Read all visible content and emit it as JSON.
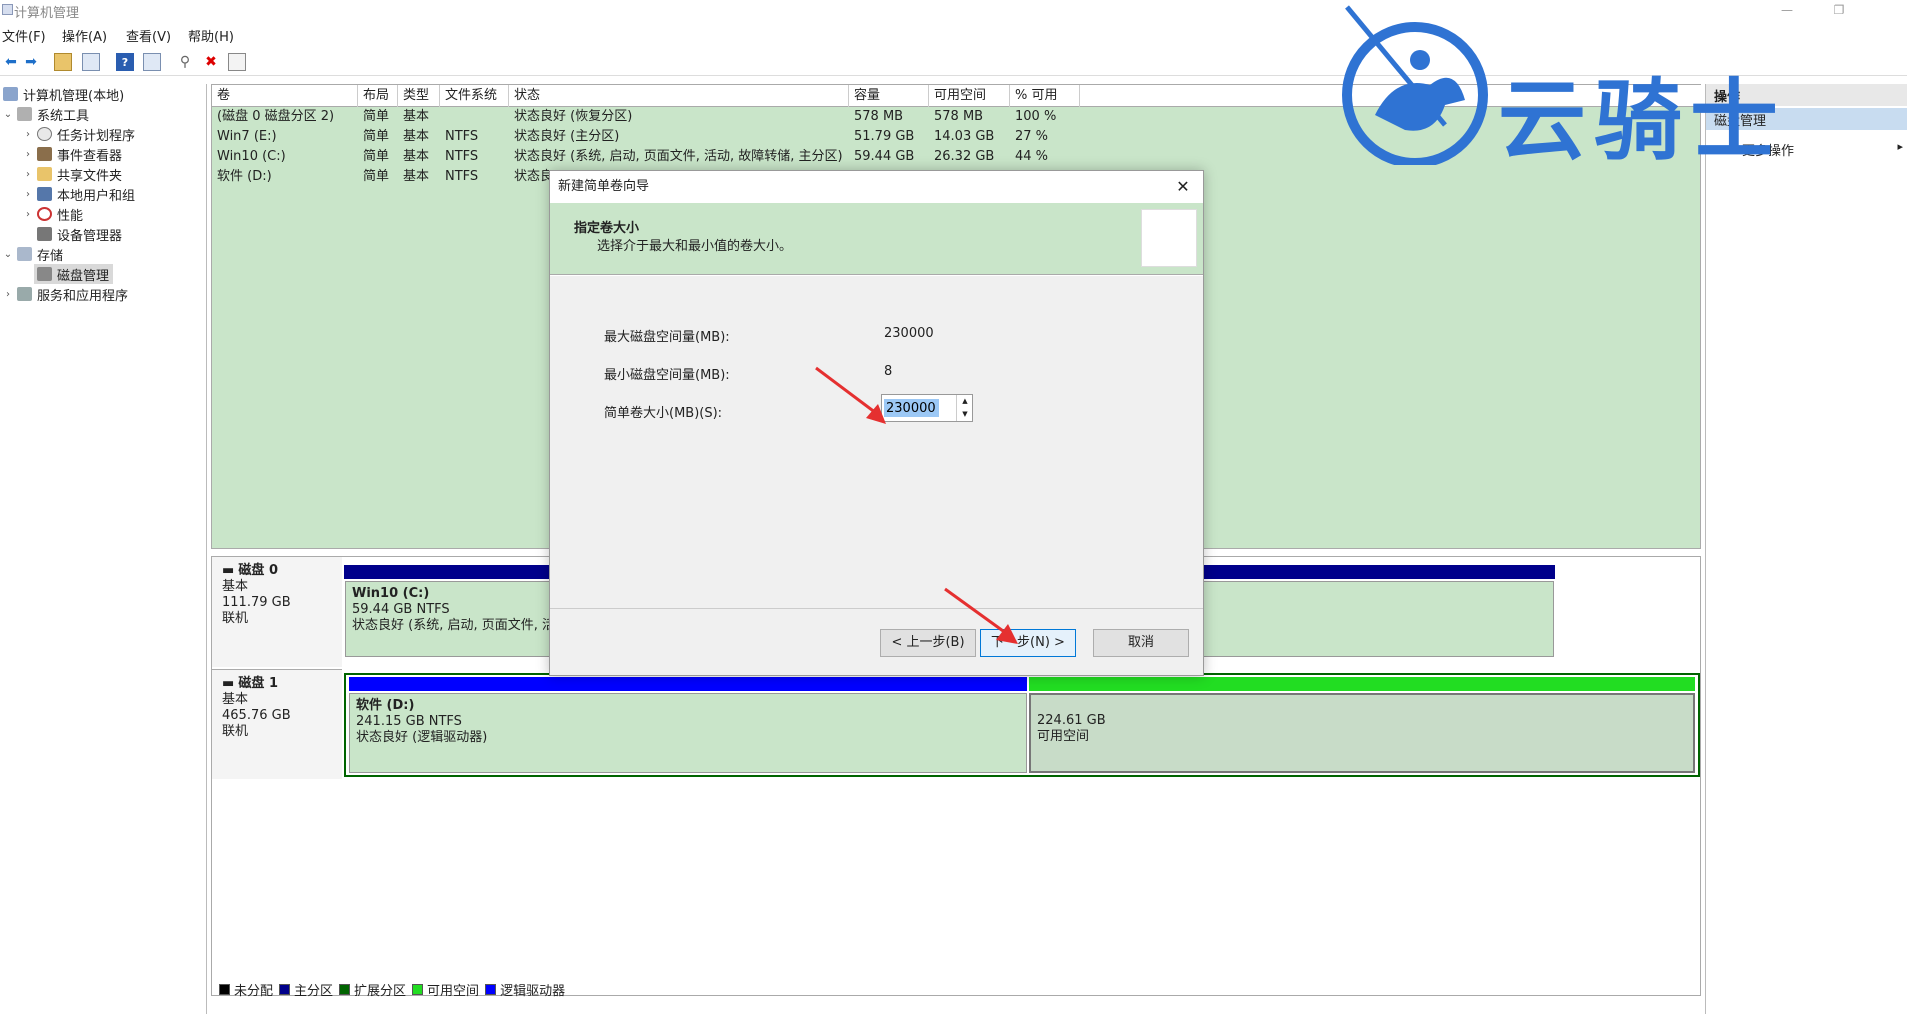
{
  "window": {
    "title": "计算机管理",
    "min": "—",
    "restore": "❐",
    "close": "✕"
  },
  "menu": [
    "文件(F)",
    "操作(A)",
    "查看(V)",
    "帮助(H)"
  ],
  "tree": {
    "root": "计算机管理(本地)",
    "system_tools": "系统工具",
    "task_scheduler": "任务计划程序",
    "event_viewer": "事件查看器",
    "shared_folders": "共享文件夹",
    "local_users": "本地用户和组",
    "performance": "性能",
    "device_manager": "设备管理器",
    "storage": "存储",
    "disk_management": "磁盘管理",
    "services": "服务和应用程序"
  },
  "volumes": {
    "headers": [
      "卷",
      "布局",
      "类型",
      "文件系统",
      "状态",
      "容量",
      "可用空间",
      "% 可用"
    ],
    "rows": [
      [
        "(磁盘 0 磁盘分区 2)",
        "简单",
        "基本",
        "",
        "状态良好 (恢复分区)",
        "578 MB",
        "578 MB",
        "100 %"
      ],
      [
        "Win7 (E:)",
        "简单",
        "基本",
        "NTFS",
        "状态良好 (主分区)",
        "51.79 GB",
        "14.03 GB",
        "27 %"
      ],
      [
        "Win10 (C:)",
        "简单",
        "基本",
        "NTFS",
        "状态良好 (系统, 启动, 页面文件, 活动, 故障转储, 主分区)",
        "59.44 GB",
        "26.32 GB",
        "44 %"
      ],
      [
        "软件 (D:)",
        "简单",
        "基本",
        "NTFS",
        "状态良",
        "",
        "",
        ""
      ]
    ]
  },
  "disks": {
    "disk0": {
      "name": "磁盘 0",
      "type": "基本",
      "size": "111.79 GB",
      "status": "联机",
      "part": {
        "name": "Win10  (C:)",
        "size": "59.44 GB NTFS",
        "status": "状态良好 (系统, 启动, 页面文件, 活"
      }
    },
    "disk1": {
      "name": "磁盘 1",
      "type": "基本",
      "size": "465.76 GB",
      "status": "联机",
      "part1": {
        "name": "软件  (D:)",
        "size": "241.15 GB NTFS",
        "status": "状态良好 (逻辑驱动器)"
      },
      "part2": {
        "size": "224.61 GB",
        "status": "可用空间"
      }
    }
  },
  "legend": [
    "未分配",
    "主分区",
    "扩展分区",
    "可用空间",
    "逻辑驱动器"
  ],
  "legend_colors": [
    "#000000",
    "#00008b",
    "#006400",
    "#22dd22",
    "#0000ff"
  ],
  "actions": {
    "header": "操作",
    "sub": "磁盘管理",
    "more": "更多操作"
  },
  "logo": {
    "text": "云骑士"
  },
  "dialog": {
    "title": "新建简单卷向导",
    "heading": "指定卷大小",
    "subheading": "选择介于最大和最小值的卷大小。",
    "max_label": "最大磁盘空间量(MB):",
    "max_value": "230000",
    "min_label": "最小磁盘空间量(MB):",
    "min_value": "8",
    "size_label": "简单卷大小(MB)(S):",
    "size_value": "230000",
    "back": "< 上一步(B)",
    "next": "下一步(N) >",
    "cancel": "取消"
  }
}
